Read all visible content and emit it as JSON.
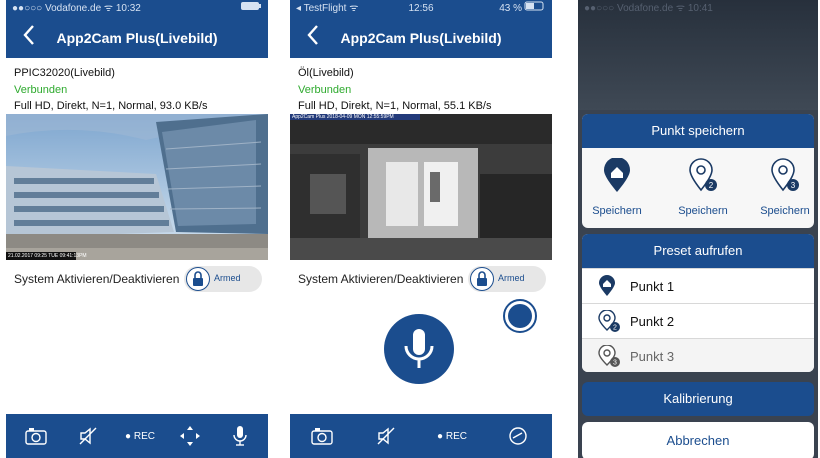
{
  "colors": {
    "brand": "#1b4d8e",
    "connected": "#2eaa2e"
  },
  "screens": [
    {
      "status": {
        "left": "●●○○○ Vodafone.de ᯤ 10:32",
        "right": ""
      },
      "nav": {
        "back_icon": "chevron-left",
        "title": "App2Cam Plus(Livebild)"
      },
      "camera_name": "PPIC32020(Livebild)",
      "connection": "Verbunden",
      "stream_info": "Full HD, Direkt, N=1, Normal, 93.0 KB/s",
      "overlay_text": "21.02.2017 09:25 TUE 09:41:13PM",
      "system_label": "System Aktivieren/Deaktivieren",
      "armed_label": "Armed",
      "tabs": [
        "camera-icon",
        "speaker-mute-icon",
        "rec",
        "move-icon",
        "microphone-icon"
      ],
      "rec_label": "● REC"
    },
    {
      "status": {
        "left": "◂ TestFlight ᯤ",
        "center": "12:56",
        "right": "43 %"
      },
      "nav": {
        "back_icon": "chevron-left",
        "title": "App2Cam Plus(Livebild)"
      },
      "camera_name": "Öl(Livebild)",
      "connection": "Verbunden",
      "stream_info": "Full HD, Direkt, N=1, Normal, 55.1 KB/s",
      "overlay_text": "App2Cam Plus 2018-04-09 MON 12:55:59PM",
      "system_label": "System Aktivieren/Deaktivieren",
      "armed_label": "Armed",
      "tabs": [
        "camera-icon",
        "speaker-mute-icon",
        "rec",
        "gauge-icon"
      ],
      "rec_label": "● REC"
    },
    {
      "status": {
        "left": "●●○○○ Vodafone.de ᯤ 10:41"
      },
      "save_sheet": {
        "title": "Punkt speichern",
        "points": [
          {
            "icon": "home-pin-icon",
            "label": "Speichern"
          },
          {
            "icon": "pin-2-icon",
            "label": "Speichern"
          },
          {
            "icon": "pin-3-icon",
            "label": "Speichern"
          }
        ]
      },
      "preset_sheet": {
        "title": "Preset aufrufen",
        "items": [
          {
            "icon": "home-pin-icon",
            "label": "Punkt 1"
          },
          {
            "icon": "pin-2-icon",
            "label": "Punkt 2"
          },
          {
            "icon": "pin-3-icon",
            "label": "Punkt 3"
          }
        ]
      },
      "calibrate_label": "Kalibrierung",
      "cancel_label": "Abbrechen"
    }
  ]
}
